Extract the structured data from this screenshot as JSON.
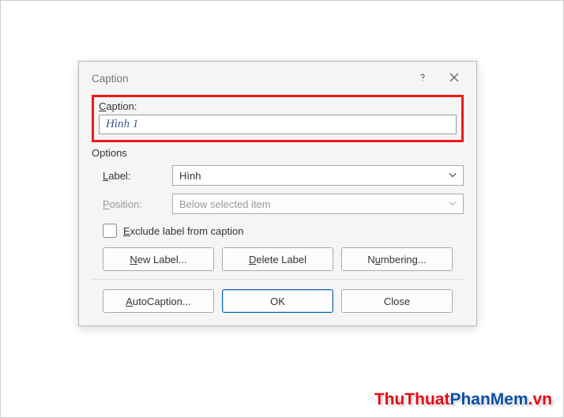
{
  "dialog": {
    "title": "Caption",
    "caption_label": "Caption:",
    "caption_value": "Hình 1",
    "options_label": "Options",
    "label_field": {
      "label": "Label:",
      "value": "Hình"
    },
    "position_field": {
      "label": "Position:",
      "value": "Below selected item"
    },
    "exclude_label": "Exclude label from caption",
    "buttons": {
      "new_label": "New Label...",
      "delete_label": "Delete Label",
      "numbering": "Numbering...",
      "autocaption": "AutoCaption...",
      "ok": "OK",
      "close": "Close"
    }
  },
  "watermark": {
    "part1": "ThuThuat",
    "part2": "PhanMem",
    "part3": ".vn"
  }
}
